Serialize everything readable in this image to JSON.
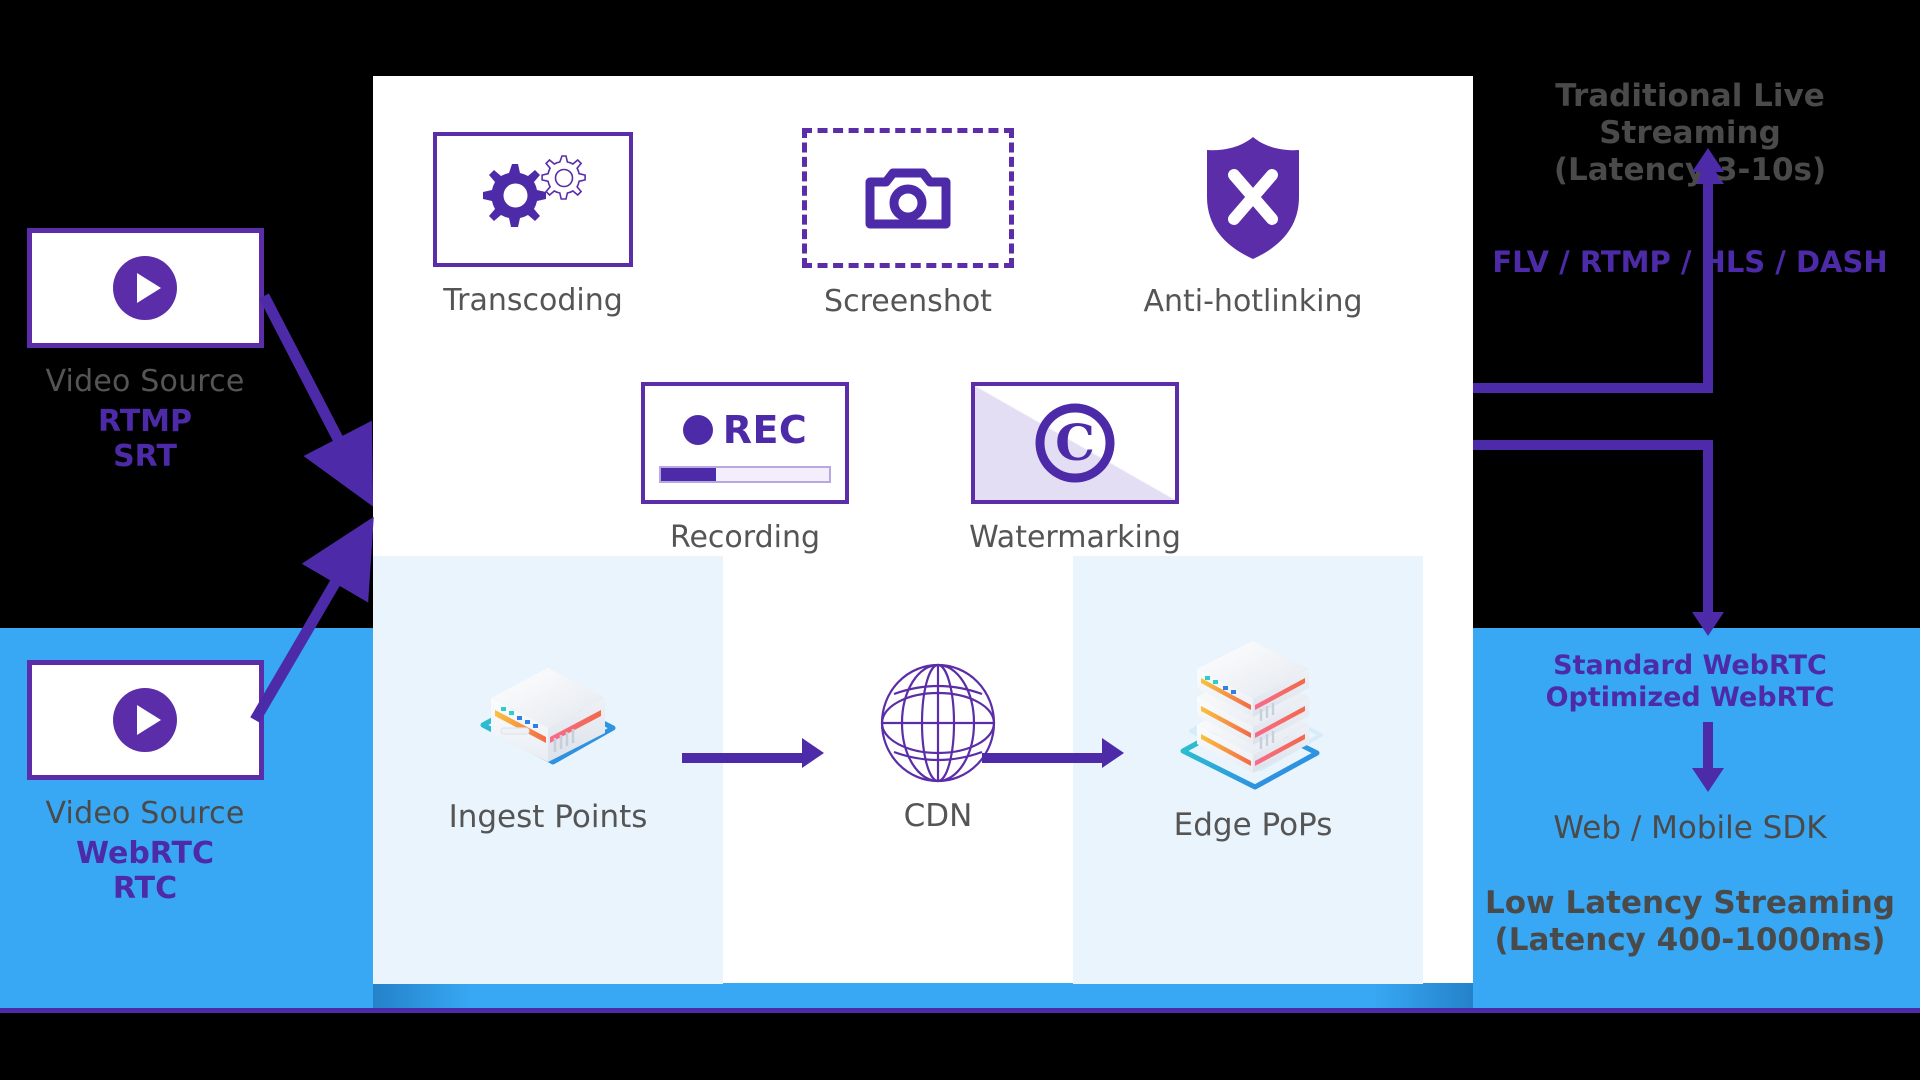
{
  "sources": [
    {
      "id": "rtmp",
      "caption": "Video Source",
      "protocols": "RTMP\nSRT",
      "proto_line1": "RTMP",
      "proto_line2": "SRT"
    },
    {
      "id": "webrtc",
      "caption": "Video Source",
      "proto_line1": "WebRTC",
      "proto_line2": "RTC"
    }
  ],
  "features": [
    {
      "id": "transcoding",
      "label": "Transcoding",
      "icon": "gears-icon"
    },
    {
      "id": "screenshot",
      "label": "Screenshot",
      "icon": "camera-icon"
    },
    {
      "id": "anti-hotlinking",
      "label": "Anti-hotlinking",
      "icon": "shield-x-icon"
    },
    {
      "id": "recording",
      "label": "Recording",
      "icon": "rec-icon",
      "rec_text": "REC",
      "progress": 33
    },
    {
      "id": "watermarking",
      "label": "Watermarking",
      "icon": "copyright-icon"
    }
  ],
  "pipeline": [
    {
      "id": "ingest",
      "label": "Ingest Points",
      "icon": "server-box-icon"
    },
    {
      "id": "cdn",
      "label": "CDN",
      "icon": "globe-icon"
    },
    {
      "id": "edge",
      "label": "Edge PoPs",
      "icon": "server-stack-icon"
    }
  ],
  "outputs": {
    "traditional": {
      "title_line1": "Traditional Live Streaming",
      "title_line2": "(Latency 3-10s)",
      "protocols": "FLV / RTMP / HLS / DASH"
    },
    "lowlatency": {
      "protocol_line1": "Standard WebRTC",
      "protocol_line2": "Optimized WebRTC",
      "sdk": "Web / Mobile SDK",
      "title_line1": "Low Latency Streaming",
      "title_line2": "(Latency 400-1000ms)"
    }
  },
  "colors": {
    "purple": "#5b2da8",
    "purple_dark": "#4d2ba8",
    "blue_band": "#38a8f4",
    "panel_white": "#ffffff",
    "subpanel": "#eaf4fd",
    "gray_text": "#555555"
  }
}
